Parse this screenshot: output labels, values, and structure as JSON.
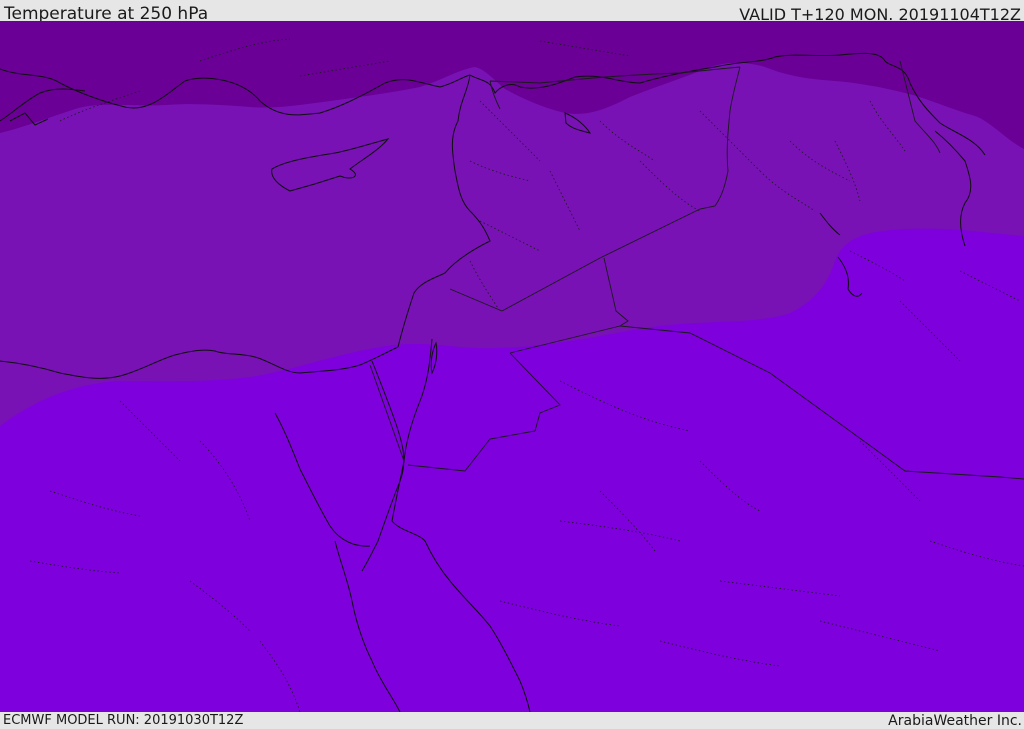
{
  "header": {
    "title": "Temperature at 250 hPa",
    "valid": "VALID T+120 MON. 20191104T12Z"
  },
  "footer": {
    "model_run": "ECMWF MODEL RUN: 20191030T12Z",
    "credit": "ArabiaWeather Inc."
  },
  "map": {
    "colors": {
      "band_cold": "#6a0096",
      "band_mid": "#7812b4",
      "band_warm": "#7e00dc",
      "coastline": "#101010",
      "border": "#1a1a1a"
    }
  }
}
